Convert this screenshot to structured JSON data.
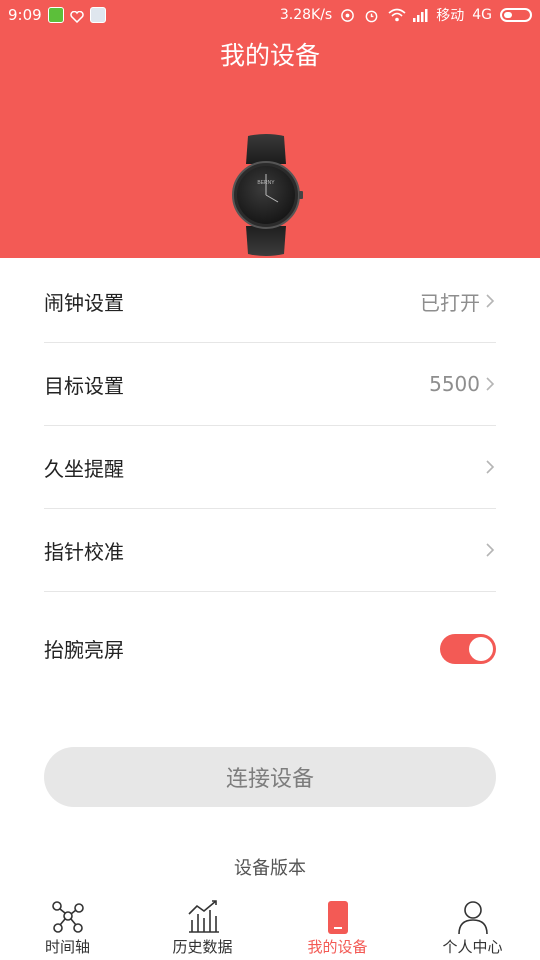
{
  "status_bar": {
    "time": "9:09",
    "speed": "3.28K/s",
    "carrier": "移动",
    "network": "4G"
  },
  "header": {
    "title": "我的设备",
    "watch_brand": "BERNY"
  },
  "settings": [
    {
      "label": "闹钟设置",
      "value": "已打开"
    },
    {
      "label": "目标设置",
      "value": "5500"
    },
    {
      "label": "久坐提醒",
      "value": ""
    },
    {
      "label": "指针校准",
      "value": ""
    }
  ],
  "wrist_raise": {
    "label": "抬腕亮屏",
    "enabled": true
  },
  "connect_button": "连接设备",
  "device_version_label": "设备版本",
  "tabs": [
    {
      "label": "时间轴",
      "icon": "timeline-icon"
    },
    {
      "label": "历史数据",
      "icon": "history-chart-icon"
    },
    {
      "label": "我的设备",
      "icon": "device-icon",
      "active": true
    },
    {
      "label": "个人中心",
      "icon": "person-icon"
    }
  ],
  "colors": {
    "accent": "#f35a55",
    "button_bg": "#e7e7e7"
  }
}
